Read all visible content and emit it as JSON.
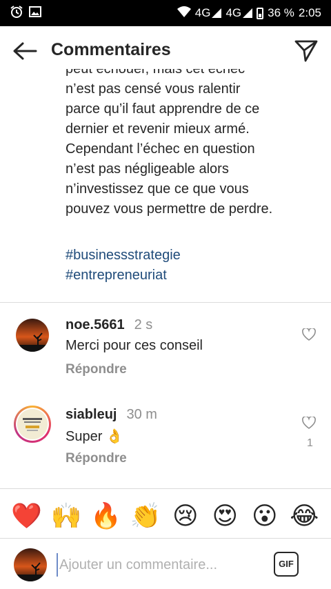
{
  "status_bar": {
    "network1": "4G",
    "network2": "4G",
    "battery": "36 %",
    "time": "2:05"
  },
  "header": {
    "title": "Commentaires"
  },
  "caption": {
    "lines": [
      "peut échouer, mais cet échec",
      "n’est pas censé vous ralentir",
      "parce qu’il faut apprendre de ce",
      "dernier et revenir mieux armé.",
      "Cependant l’échec en question",
      "n’est pas négligeable alors",
      "n’investissez que ce que vous",
      "pouvez vous permettre de perdre."
    ],
    "hashtags": [
      "#businessstrategie",
      "#entrepreneuriat"
    ]
  },
  "comments": [
    {
      "username": "noe.5661",
      "time": "2 s",
      "text": "Merci pour ces conseil",
      "reply_label": "Répondre",
      "likes": ""
    },
    {
      "username": "siableuj",
      "time": "30 m",
      "text": "Super 👌",
      "reply_label": "Répondre",
      "likes": "1"
    }
  ],
  "emoji_bar": [
    "❤️",
    "🙌",
    "🔥",
    "👏",
    "😢",
    "😍",
    "😮",
    "😂"
  ],
  "comment_input": {
    "placeholder": "Ajouter un commentaire...",
    "gif_label": "GIF"
  }
}
